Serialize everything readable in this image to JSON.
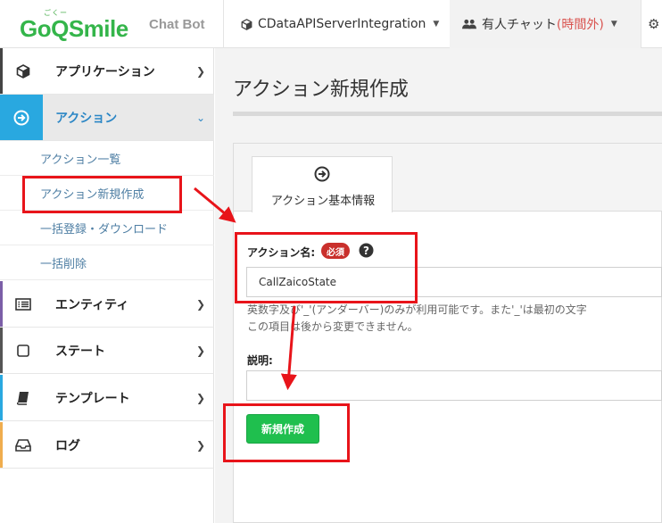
{
  "header": {
    "logo_kana": "ごくー",
    "logo_text": "GoQSmile",
    "logo_sub": "Chat Bot",
    "project_menu": "CDataAPIServerIntegration",
    "chat_menu": "有人チャット",
    "chat_status": "(時間外)"
  },
  "sidebar": {
    "items": [
      {
        "label": "アプリケーション",
        "icon": "cube-icon"
      },
      {
        "label": "アクション",
        "icon": "circle-arrow-right-icon"
      },
      {
        "label": "エンティティ",
        "icon": "list-icon"
      },
      {
        "label": "ステート",
        "icon": "square-icon"
      },
      {
        "label": "テンプレート",
        "icon": "book-icon"
      },
      {
        "label": "ログ",
        "icon": "inbox-icon"
      }
    ],
    "sub_items": [
      {
        "label": "アクション一覧"
      },
      {
        "label": "アクション新規作成"
      },
      {
        "label": "一括登録・ダウンロード"
      },
      {
        "label": "一括削除"
      }
    ]
  },
  "main": {
    "title": "アクション新規作成",
    "tab_label": "アクション基本情報",
    "name_label": "アクション名:",
    "required_badge": "必須",
    "name_value": "CallZaicoState",
    "help_line1": "英数字及び'_'(アンダーバー)のみが利用可能です。また'_'は最初の文字",
    "help_line2": "この項目は後から変更できません。",
    "desc_label": "説明:",
    "create_button": "新規作成"
  },
  "colors": {
    "brand_green": "#34b54a",
    "active_blue": "#29a8e0",
    "button_green": "#1fbf4e",
    "required_red": "#c9302c",
    "annotation_red": "#e8141a"
  }
}
